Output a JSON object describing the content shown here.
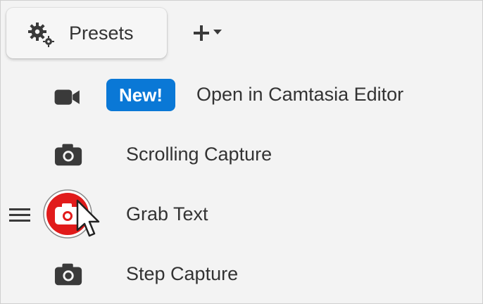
{
  "toolbar": {
    "presets_label": "Presets",
    "presets_icon": "gear-icon",
    "add_icon": "plus-icon",
    "add_dropdown_icon": "caret-down-icon"
  },
  "menu": {
    "items": [
      {
        "label": "Open in Camtasia Editor",
        "icon": "video-camera-icon",
        "badge": "New!"
      },
      {
        "label": "Scrolling Capture",
        "icon": "camera-icon"
      },
      {
        "label": "Grab Text",
        "icon": "camera-icon",
        "selected": true
      },
      {
        "label": "Step Capture",
        "icon": "camera-icon"
      }
    ]
  },
  "colors": {
    "badge_bg": "#0a78d6",
    "selected_ring": "#e11b1b",
    "icon": "#3a3a3a",
    "text": "#333333"
  }
}
